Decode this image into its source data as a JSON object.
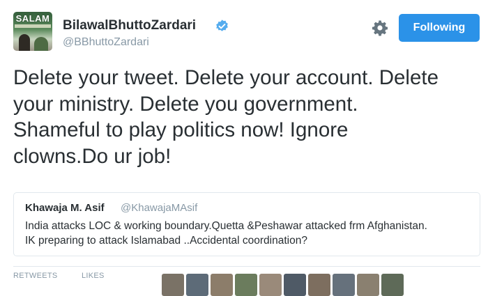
{
  "account": {
    "avatar_text": "SALAM",
    "display_name": "BilawalBhuttoZardari",
    "screen_name": "@BBhuttoZardari",
    "verified": true
  },
  "actions": {
    "follow_label": "Following",
    "accent_color": "#2b92e8"
  },
  "tweet": {
    "text": "Delete your tweet. Delete your account. Delete\nyour ministry. Delete you government.\nShameful to play politics now! Ignore\nclowns.Do ur job!"
  },
  "quoted_tweet": {
    "author": "Khawaja M. Asif",
    "screen_name": "@KhawajaMAsif",
    "text": "India attacks LOC & working boundary.Quetta &Peshawar attacked frm Afghanistan.\nIK preparing to attack Islamabad ..Accidental coordination?"
  },
  "stats": {
    "retweets_label": "RETWEETS",
    "likes_label": "LIKES"
  },
  "icons": {
    "verified": "verified-badge-icon",
    "settings": "gear-icon"
  }
}
